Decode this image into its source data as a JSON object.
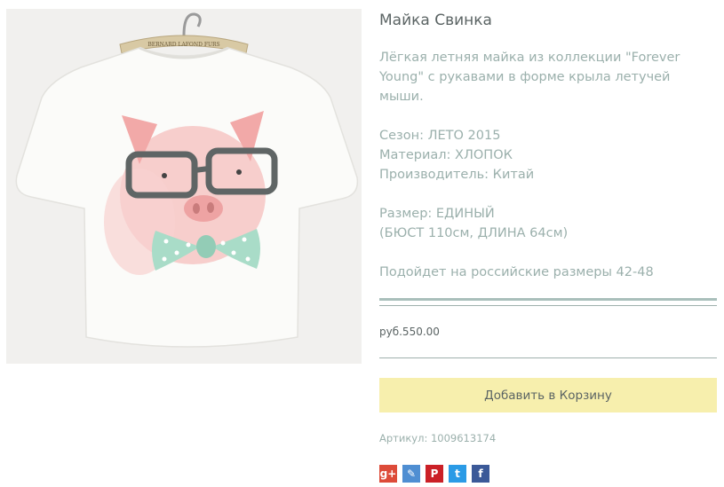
{
  "product": {
    "title": "Майка Свинка",
    "description": "Лёгкая летняя майка из коллекции \"Forever Young\" с рукавами в форме крыла летучей мыши.",
    "season": "Сезон: ЛЕТО 2015",
    "material": "Материал: ХЛОПОК",
    "manufacturer": "Производитель: Китай",
    "size": "Размер: ЕДИНЫЙ",
    "dimensions": "(БЮСТ 110см, ДЛИНА 64см)",
    "fit": "Подойдет на российские размеры 42-48",
    "price": "руб.550.00",
    "sku": "Артикул: 1009613174",
    "hanger_text": "BERNARD LAFOND FURS"
  },
  "cart": {
    "button_label": "Добавить в Корзину",
    "color": "#f7efad"
  },
  "social": [
    {
      "name": "google-plus-icon",
      "glyph": "g+",
      "color": "#dd4b39"
    },
    {
      "name": "livejournal-icon",
      "glyph": "✎",
      "color": "#4f8ed2"
    },
    {
      "name": "pinterest-icon",
      "glyph": "P",
      "color": "#cb2027"
    },
    {
      "name": "twitter-icon",
      "glyph": "t",
      "color": "#2b9be6"
    },
    {
      "name": "facebook-icon",
      "glyph": "f",
      "color": "#3b5998"
    }
  ],
  "colors": {
    "text_muted": "#9bb0ac",
    "text_dark": "#5b6464",
    "divider": "#a9bfbb"
  }
}
